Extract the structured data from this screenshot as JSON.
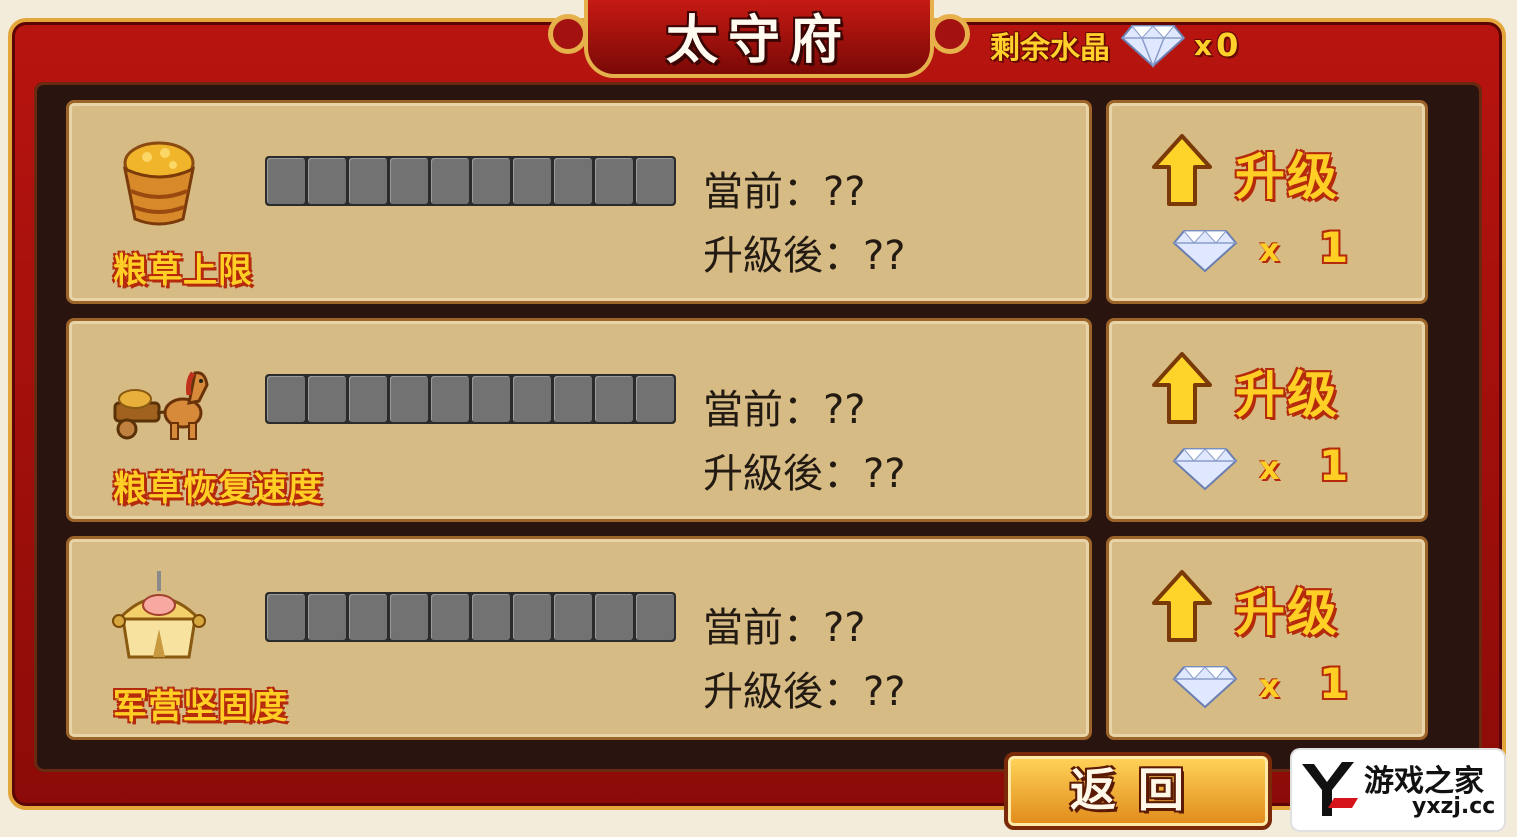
{
  "header": {
    "title": "太守府",
    "crystal_label": "剩余水晶",
    "crystal_times": "x",
    "crystal_count": "0"
  },
  "rows": [
    {
      "name": "粮草上限",
      "icon": "grain-basket-icon",
      "current": "當前：??",
      "after": "升級後：??",
      "upgrade_label": "升级",
      "cost_times": "x",
      "cost": "1"
    },
    {
      "name": "粮草恢复速度",
      "icon": "horse-cart-icon",
      "current": "當前：??",
      "after": "升級後：??",
      "upgrade_label": "升级",
      "cost_times": "x",
      "cost": "1"
    },
    {
      "name": "军营坚固度",
      "icon": "army-tent-icon",
      "current": "當前：??",
      "after": "升級後：??",
      "upgrade_label": "升级",
      "cost_times": "x",
      "cost": "1"
    }
  ],
  "footer": {
    "back_label": "返回"
  },
  "logo": {
    "name": "游戏之家",
    "domain": "yxzj.cc"
  },
  "colors": {
    "frame_red": "#b8140f",
    "panel_tan": "#d6bb85",
    "gold_text": "#ffcf26",
    "segment_gray": "#727272"
  }
}
